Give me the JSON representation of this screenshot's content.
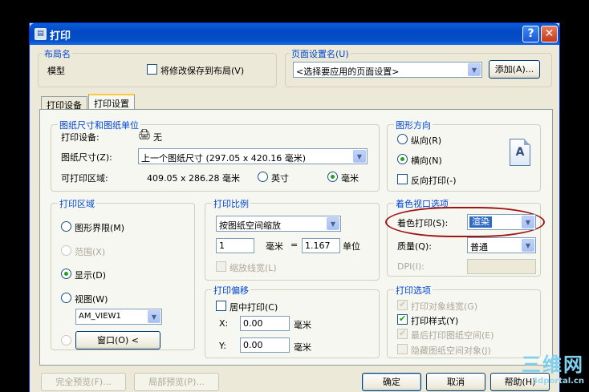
{
  "window": {
    "title": "打印",
    "help_label": "?",
    "close_label": "✕"
  },
  "layout_group": {
    "legend": "布局名",
    "name": "模型",
    "save_checkbox_label": "将修改保存到布局(V)"
  },
  "page_setup_group": {
    "legend": "页面设置名(U)",
    "combo_value": "<选择要应用的页面设置>",
    "add_button": "添加(A)..."
  },
  "tabs": [
    {
      "label": "打印设备"
    },
    {
      "label": "打印设置"
    }
  ],
  "paper": {
    "legend": "图纸尺寸和图纸单位",
    "device_label": "打印设备:",
    "device_value": "无",
    "size_label": "图纸尺寸(Z):",
    "size_value": "上一个图纸尺寸 (297.05 x 420.16 毫米)",
    "area_label": "可打印区域:",
    "area_value": "409.05 x 286.28 毫米",
    "unit_inch": "英寸",
    "unit_mm": "毫米"
  },
  "orientation": {
    "legend": "图形方向",
    "portrait": "纵向(R)",
    "landscape": "横向(N)",
    "reverse": "反向打印(-)",
    "icon_letter": "A"
  },
  "print_area": {
    "legend": "打印区域",
    "limits": "图形界限(M)",
    "extents": "范围(X)",
    "display": "显示(D)",
    "view": "视图(W)",
    "view_value": "AM_VIEW1",
    "window_button": "窗口(O) <"
  },
  "scale": {
    "legend": "打印比例",
    "combo_value": "按图纸空间缩放",
    "value1": "1",
    "unit1": "毫米",
    "equals": "=",
    "value2": "1.167",
    "unit2": "单位",
    "scale_lineweights": "缩放线宽(L)"
  },
  "offset": {
    "legend": "打印偏移",
    "center": "居中打印(C)",
    "x_label": "X:",
    "x_value": "0.00",
    "x_unit": "毫米",
    "y_label": "Y:",
    "y_value": "0.00",
    "y_unit": "毫米"
  },
  "shaded": {
    "legend": "着色视口选项",
    "shade_label": "着色打印(S):",
    "shade_value": "渲染",
    "quality_label": "质量(Q):",
    "quality_value": "普通",
    "dpi_label": "DPI(I):"
  },
  "options": {
    "legend": "打印选项",
    "lineweights": "打印对象线宽(G)",
    "plot_styles": "打印样式(Y)",
    "paperspace_last": "最后打印图纸空间(E)",
    "hide_objects": "隐藏图纸空间对象(J)"
  },
  "footer": {
    "full_preview": "完全预览(F)...",
    "partial_preview": "局部预览(P)...",
    "ok": "确定",
    "cancel": "取消",
    "help": "帮助(H)"
  },
  "watermark": {
    "big": "三维网",
    "small": "3dportal.cn"
  }
}
